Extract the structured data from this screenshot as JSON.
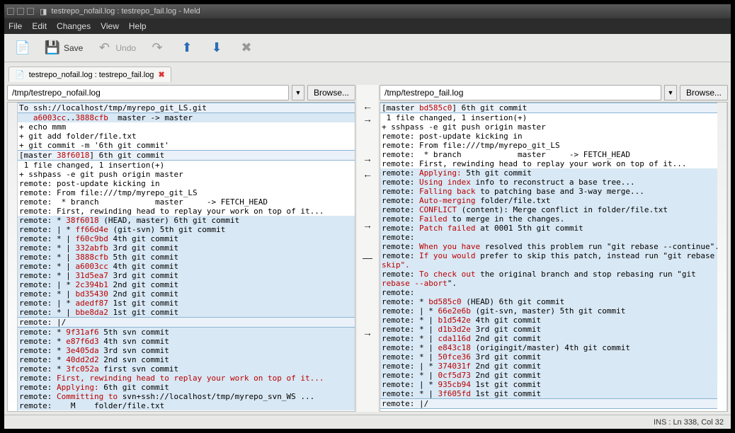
{
  "window": {
    "title": "testrepo_nofail.log : testrepo_fail.log - Meld"
  },
  "menubar": [
    "File",
    "Edit",
    "Changes",
    "View",
    "Help"
  ],
  "toolbar": {
    "save": "Save",
    "undo": "Undo"
  },
  "tab": {
    "label": "testrepo_nofail.log : testrepo_fail.log"
  },
  "left": {
    "path": "/tmp/testrepo_nofail.log",
    "browse": "Browse...",
    "lines": [
      {
        "t": "To ssh://localhost/tmp/myrepo_git_LS.git",
        "cls": "hl-modline"
      },
      {
        "t": "   a6003cc..3888cfb  master -> master",
        "cls": "hl-blue",
        "hash": true
      },
      {
        "t": "+ echo mmm"
      },
      {
        "t": "+ git add folder/file.txt"
      },
      {
        "t": "+ git commit -m '6th git commit'"
      },
      {
        "t": "[master 38f6018] 6th git commit",
        "cls": "hl-modline",
        "hash": true
      },
      {
        "t": " 1 file changed, 1 insertion(+)"
      },
      {
        "t": "+ sshpass -e git push origin master"
      },
      {
        "t": "remote: post-update kicking in"
      },
      {
        "t": "remote: From file:///tmp/myrepo_git_LS"
      },
      {
        "t": "remote:  * branch            master     -> FETCH_HEAD"
      },
      {
        "t": "remote: First, rewinding head to replay your work on top of it..."
      },
      {
        "t": "remote: * 38f6018 (HEAD, master) 6th git commit",
        "cls": "hl-blue",
        "hash": true
      },
      {
        "t": "remote: | * ff66d4e (git-svn) 5th git commit",
        "cls": "hl-blue",
        "hash": true
      },
      {
        "t": "remote: * | f60c9bd 4th git commit",
        "cls": "hl-blue",
        "hash": true
      },
      {
        "t": "remote: * | 332abfb 3rd git commit",
        "cls": "hl-blue",
        "hash": true
      },
      {
        "t": "remote: * | 3888cfb 5th git commit",
        "cls": "hl-blue",
        "hash": true
      },
      {
        "t": "remote: * | a6003cc 4th git commit",
        "cls": "hl-blue",
        "hash": true
      },
      {
        "t": "remote: * | 31d5ea7 3rd git commit",
        "cls": "hl-blue",
        "hash": true
      },
      {
        "t": "remote: | * 2c394b1 2nd git commit",
        "cls": "hl-blue",
        "hash": true
      },
      {
        "t": "remote: * | bd35430 2nd git commit",
        "cls": "hl-blue",
        "hash": true
      },
      {
        "t": "remote: | * adedf87 1st git commit",
        "cls": "hl-blue",
        "hash": true
      },
      {
        "t": "remote: * | bbe8da2 1st git commit",
        "cls": "hl-blue",
        "hash": true
      },
      {
        "t": "remote: |/",
        "cls": "hl-modline"
      },
      {
        "t": "remote: * 9f31af6 5th svn commit",
        "hash": true,
        "cls": "hl-blue"
      },
      {
        "t": "remote: * e87f6d3 4th svn commit",
        "hash": true,
        "cls": "hl-blue"
      },
      {
        "t": "remote: * 3e405da 3rd svn commit",
        "hash": true,
        "cls": "hl-blue"
      },
      {
        "t": "remote: * 40dd2d2 2nd svn commit",
        "hash": true,
        "cls": "hl-blue"
      },
      {
        "t": "remote: * 3fc052a first svn commit",
        "hash": true,
        "cls": "hl-blue"
      },
      {
        "t": "remote: First, rewinding head to replay your work on top of it...",
        "cls": "hl-blue",
        "hash": true
      },
      {
        "t": "remote: Applying: 6th git commit",
        "cls": "hl-blue",
        "hash": true
      },
      {
        "t": "remote: Committing to svn+ssh://localhost/tmp/myrepo_svn_WS ...",
        "cls": "hl-blue",
        "hash": true
      },
      {
        "t": "remote:    M    folder/file.txt",
        "cls": "hl-blue",
        "hash": true
      }
    ]
  },
  "right": {
    "path": "/tmp/testrepo_fail.log",
    "browse": "Browse...",
    "lines": [
      {
        "t": "[master bd585c0] 6th git commit",
        "cls": "hl-modline",
        "hash": true
      },
      {
        "t": " 1 file changed, 1 insertion(+)"
      },
      {
        "t": "+ sshpass -e git push origin master"
      },
      {
        "t": "remote: post-update kicking in"
      },
      {
        "t": "remote: From file:///tmp/myrepo_git_LS"
      },
      {
        "t": "remote:  * branch            master     -> FETCH_HEAD"
      },
      {
        "t": "remote: First, rewinding head to replay your work on top of it..."
      },
      {
        "t": "remote: Applying: 5th git commit",
        "cls": "hl-blue",
        "hash": true
      },
      {
        "t": "remote: Using index info to reconstruct a base tree...",
        "cls": "hl-blue",
        "hash": true
      },
      {
        "t": "remote: Falling back to patching base and 3-way merge...",
        "cls": "hl-blue",
        "hash": true
      },
      {
        "t": "remote: Auto-merging folder/file.txt",
        "cls": "hl-blue",
        "hash": true
      },
      {
        "t": "remote: CONFLICT (content): Merge conflict in folder/file.txt",
        "cls": "hl-blue",
        "hash": true
      },
      {
        "t": "remote: Failed to merge in the changes.",
        "cls": "hl-blue",
        "hash": true
      },
      {
        "t": "remote: Patch failed at 0001 5th git commit",
        "cls": "hl-blue",
        "hash": true
      },
      {
        "t": "remote:",
        "cls": "hl-blue",
        "hash": true
      },
      {
        "t": "remote: When you have resolved this problem run \"git rebase --continue\".",
        "cls": "hl-blue",
        "hash": true
      },
      {
        "t": "remote: If you would prefer to skip this patch, instead run \"git rebase --",
        "cls": "hl-blue",
        "hash": true
      },
      {
        "t": "skip\".",
        "cls": "hl-blue",
        "hash": true
      },
      {
        "t": "remote: To check out the original branch and stop rebasing run \"git",
        "cls": "hl-blue",
        "hash": true
      },
      {
        "t": "rebase --abort\".",
        "cls": "hl-blue",
        "hash": true
      },
      {
        "t": "remote:",
        "cls": "hl-blue",
        "hash": true
      },
      {
        "t": "remote: * bd585c0 (HEAD) 6th git commit",
        "cls": "hl-blue",
        "hash": true
      },
      {
        "t": "remote: | * 66e2e6b (git-svn, master) 5th git commit",
        "cls": "hl-blue",
        "hash": true
      },
      {
        "t": "remote: * | b1d542e 4th git commit",
        "cls": "hl-blue",
        "hash": true
      },
      {
        "t": "remote: * | d1b3d2e 3rd git commit",
        "cls": "hl-blue",
        "hash": true
      },
      {
        "t": "remote: * | cda116d 2nd git commit",
        "cls": "hl-blue",
        "hash": true
      },
      {
        "t": "remote: * | e843c18 (origingit/master) 4th git commit",
        "cls": "hl-blue",
        "hash": true
      },
      {
        "t": "remote: * | 50fce36 3rd git commit",
        "cls": "hl-blue",
        "hash": true
      },
      {
        "t": "remote: | * 374031f 2nd git commit",
        "cls": "hl-blue",
        "hash": true
      },
      {
        "t": "remote: * | 0cf5d73 2nd git commit",
        "cls": "hl-blue",
        "hash": true
      },
      {
        "t": "remote: | * 935cb94 1st git commit",
        "cls": "hl-blue",
        "hash": true
      },
      {
        "t": "remote: * | 3f605fd 1st git commit",
        "cls": "hl-blue",
        "hash": true
      },
      {
        "t": "remote: |/",
        "cls": "hl-modline"
      }
    ]
  },
  "status": "INS : Ln 338, Col 32",
  "colors": {
    "blue": "#d8e8f4",
    "red": "#b00"
  }
}
